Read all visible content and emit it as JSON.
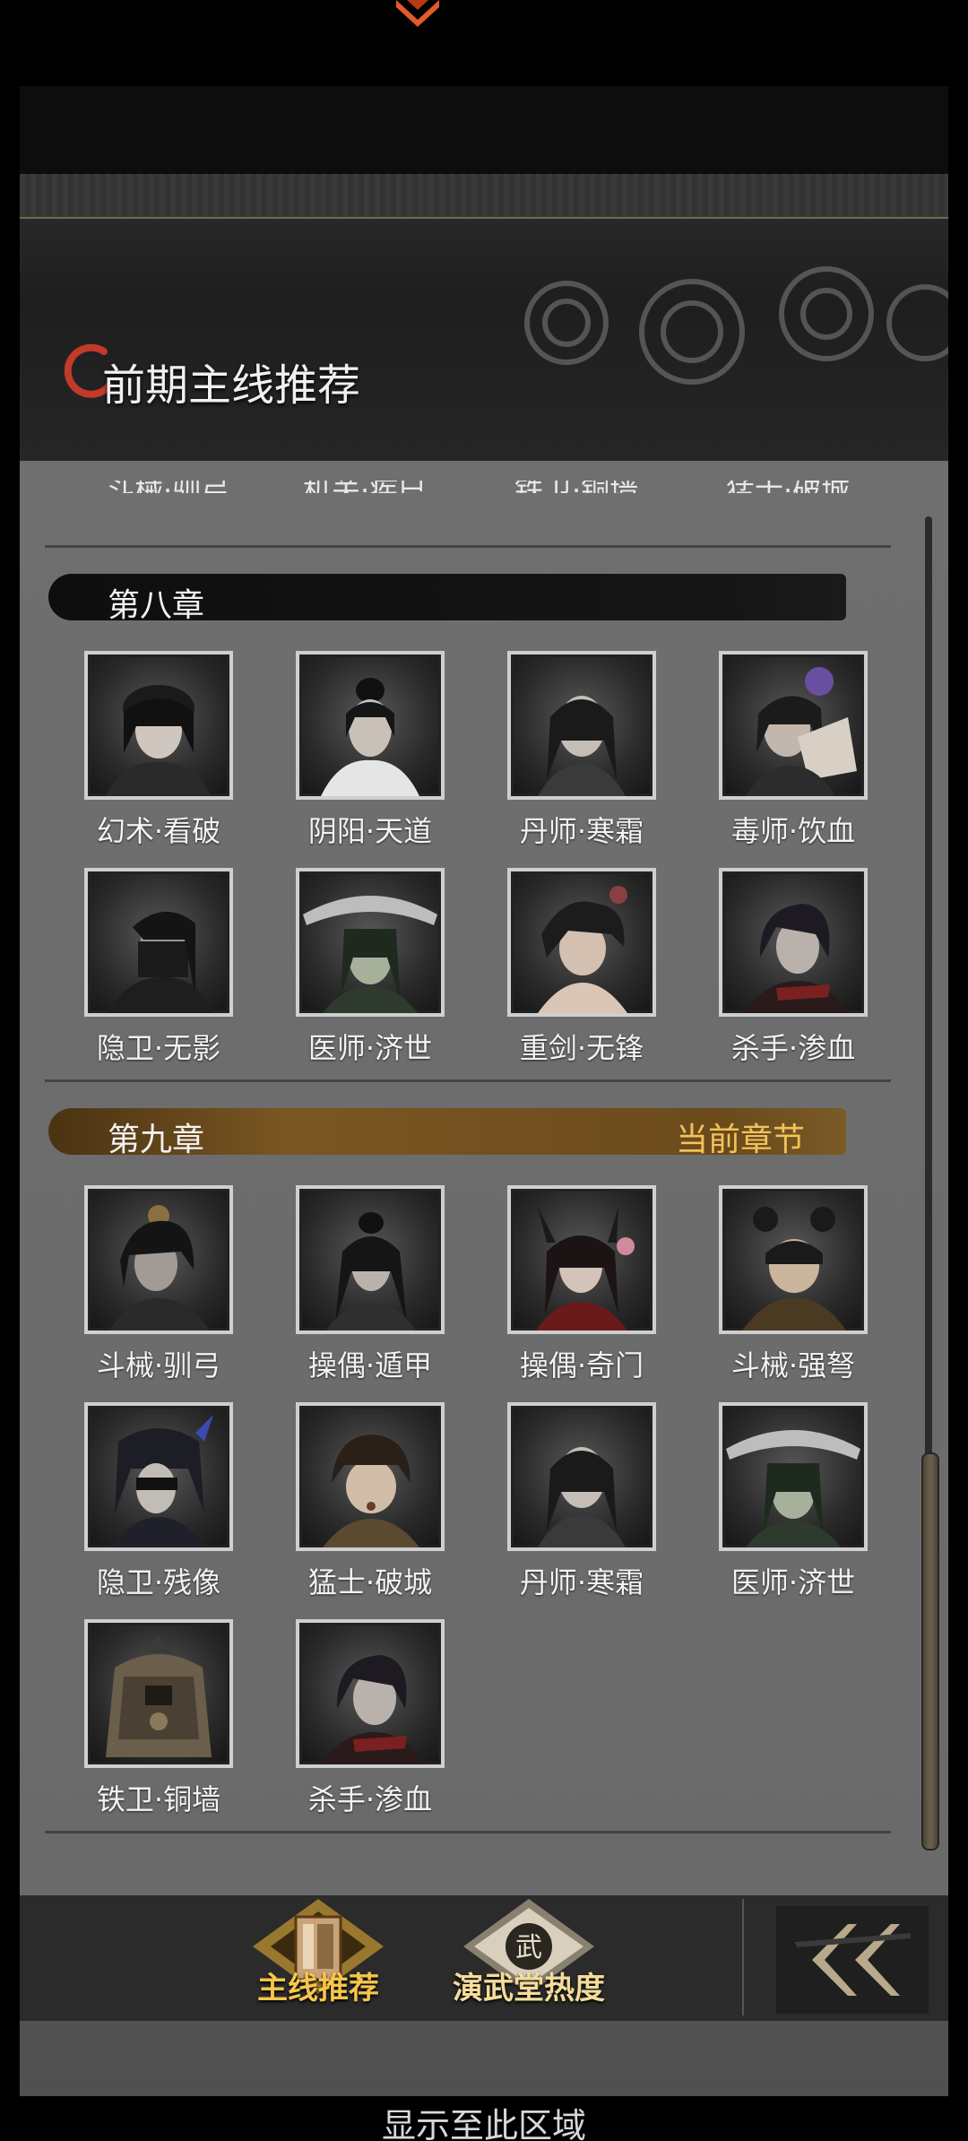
{
  "header": {
    "title": "前期主线推荐"
  },
  "clipped_row": [
    "斗械·驯弓",
    "机关·疾巳",
    "铁卫·铜墙",
    "猛士·破城"
  ],
  "chapters": [
    {
      "title": "第八章",
      "current_label": "",
      "heroes": [
        "幻术·看破",
        "阴阳·天道",
        "丹师·寒霜",
        "毒师·饮血",
        "隐卫·无影",
        "医师·济世",
        "重剑·无锋",
        "杀手·渗血"
      ]
    },
    {
      "title": "第九章",
      "current_label": "当前章节",
      "heroes": [
        "斗械·驯弓",
        "操偶·遁甲",
        "操偶·奇门",
        "斗械·强弩",
        "隐卫·残像",
        "猛士·破城",
        "丹师·寒霜",
        "医师·济世",
        "铁卫·铜墙",
        "杀手·渗血"
      ]
    }
  ],
  "bottom_tabs": [
    {
      "label": "主线推荐",
      "icon": "scroll-book-icon",
      "active": true
    },
    {
      "label": "演武堂热度",
      "icon": "wu-emblem-icon",
      "active": false
    }
  ],
  "back_button": {
    "icon": "double-chevron-left-icon"
  },
  "footer": {
    "text": "显示至此区域"
  },
  "colors": {
    "accent_gold": "#f7c64a",
    "current_chapter_text": "#f0c35a",
    "panel_bg": "#6a6a6a",
    "header_bg": "#222222"
  }
}
